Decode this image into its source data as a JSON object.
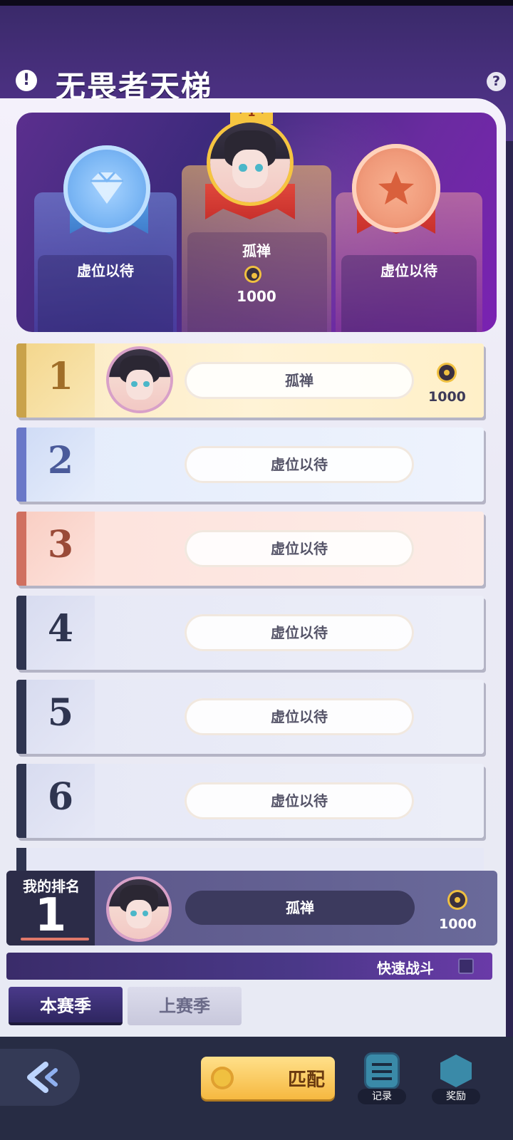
{
  "header": {
    "title": "无畏者天梯",
    "info_icon": "!",
    "help_icon": "?"
  },
  "podium": {
    "first": {
      "name": "孤禅",
      "score": "1000",
      "crown_rank": "1"
    },
    "second": {
      "name": "虚位以待"
    },
    "third": {
      "name": "虚位以待"
    }
  },
  "rows": [
    {
      "rank": "1",
      "name": "孤禅",
      "score": "1000"
    },
    {
      "rank": "2",
      "name": "虚位以待"
    },
    {
      "rank": "3",
      "name": "虚位以待"
    },
    {
      "rank": "4",
      "name": "虚位以待"
    },
    {
      "rank": "5",
      "name": "虚位以待"
    },
    {
      "rank": "6",
      "name": "虚位以待"
    }
  ],
  "my_rank": {
    "label": "我的排名",
    "rank": "1",
    "name": "孤禅",
    "score": "1000"
  },
  "quick_battle": {
    "label": "快速战斗"
  },
  "tabs": {
    "current": "本赛季",
    "previous": "上赛季"
  },
  "footer": {
    "match": "匹配",
    "records": "记录",
    "rewards": "奖励"
  },
  "colors": {
    "gold": "#f0c040",
    "purple": "#4a3080",
    "silver": "#7ba9f2",
    "bronze": "#f09a7a"
  }
}
